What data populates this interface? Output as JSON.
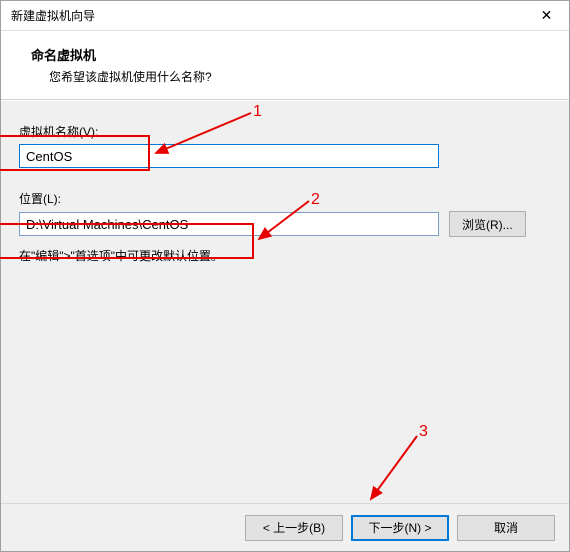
{
  "window": {
    "title": "新建虚拟机向导"
  },
  "header": {
    "title": "命名虚拟机",
    "subtitle": "您希望该虚拟机使用什么名称?"
  },
  "fields": {
    "name_label": "虚拟机名称(V):",
    "name_value": "CentOS",
    "location_label": "位置(L):",
    "location_value": "D:\\Virtual Machines\\CentOS",
    "browse_label": "浏览(R)...",
    "hint": "在\"编辑\">\"首选项\"中可更改默认位置。"
  },
  "footer": {
    "back": "< 上一步(B)",
    "next": "下一步(N) >",
    "cancel": "取消"
  },
  "annotations": {
    "num1": "1",
    "num2": "2",
    "num3": "3"
  }
}
